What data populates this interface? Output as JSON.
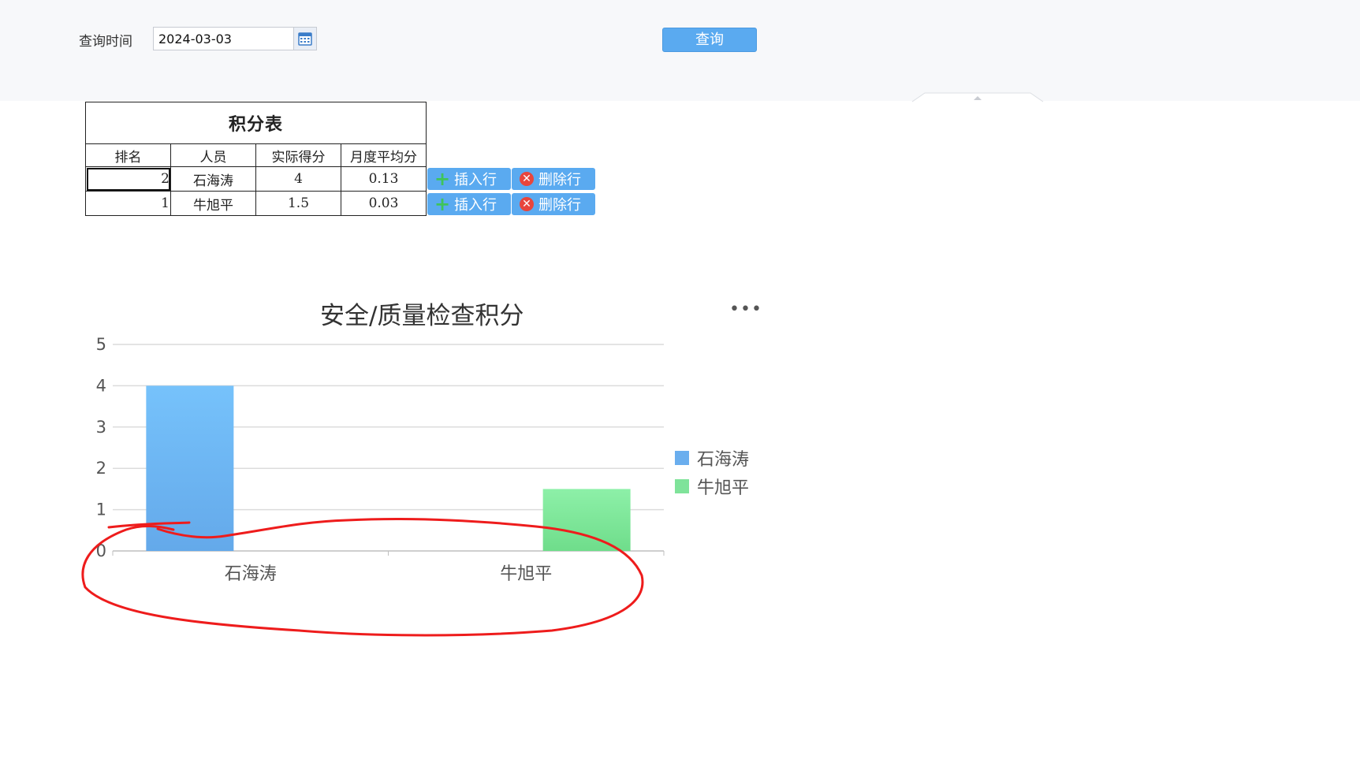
{
  "query": {
    "label": "查询时间",
    "date_value": "2024-03-03",
    "button_label": "查询"
  },
  "table": {
    "caption": "积分表",
    "headers": [
      "排名",
      "人员",
      "实际得分",
      "月度平均分"
    ],
    "rows": [
      {
        "rank": "2",
        "person": "石海涛",
        "score": "4",
        "avg": "0.13"
      },
      {
        "rank": "1",
        "person": "牛旭平",
        "score": "1.5",
        "avg": "0.03"
      }
    ],
    "insert_label": "插入行",
    "delete_label": "删除行"
  },
  "colors": {
    "button": "#5aaaf0",
    "series_1": "#6aaeee",
    "series_2": "#7fe39a",
    "annotation": "#ee1c1c"
  },
  "chart_data": {
    "type": "bar",
    "title": "安全/质量检查积分",
    "categories": [
      "石海涛",
      "牛旭平"
    ],
    "series": [
      {
        "name": "石海涛",
        "values": [
          4,
          null
        ]
      },
      {
        "name": "牛旭平",
        "values": [
          null,
          1.5
        ]
      }
    ],
    "ylim": [
      0,
      5
    ],
    "yticks": [
      "0",
      "1",
      "2",
      "3",
      "4",
      "5"
    ],
    "grid": true,
    "legend": "right"
  }
}
